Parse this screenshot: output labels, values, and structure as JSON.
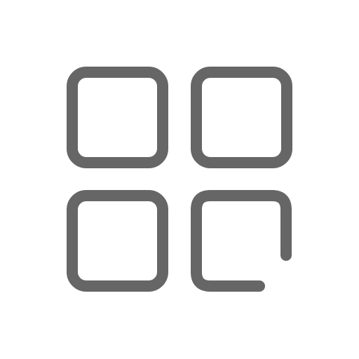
{
  "icon": {
    "name": "app-grid-icon",
    "stroke_color": "#666666",
    "background_color": "#ffffff"
  }
}
